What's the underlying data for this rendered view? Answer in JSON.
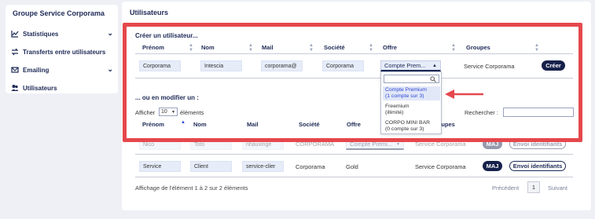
{
  "sidebar": {
    "title": "Groupe Service Corporama",
    "items": [
      {
        "label": "Statistiques",
        "icon": "chart-icon",
        "chevron": "⌄"
      },
      {
        "label": "Transferts entre utilisateurs",
        "icon": "transfer-icon"
      },
      {
        "label": "Emailing",
        "icon": "email-icon",
        "chevron": "⌄"
      },
      {
        "label": "Utilisateurs",
        "icon": "users-icon"
      }
    ]
  },
  "main": {
    "title": "Utilisateurs",
    "create": {
      "section_label": "Créer un utilisateur...",
      "headers": [
        "Prénom",
        "Nom",
        "Mail",
        "Société",
        "Offre",
        "Groupes"
      ],
      "inputs": {
        "prenom": "Corporama",
        "nom": "Intescia",
        "mail": "corporama@",
        "societe": "Corporama",
        "offre": "Compte Prem..."
      },
      "groupe": "Service Corporama",
      "create_button": "Créer"
    },
    "dropdown": {
      "options": [
        {
          "line1": "Compte Premium",
          "line2": "(1 compte sur 3)",
          "selected": true
        },
        {
          "line1": "Freemium",
          "line2": "(illimité)",
          "selected": false
        },
        {
          "line1": "CORPO MINI BAR",
          "line2": "(0 compte sur 3)",
          "selected": false
        }
      ]
    },
    "modify": {
      "section_label": "... ou en modifier un :",
      "show_prefix": "Afficher",
      "show_value": "10",
      "show_suffix": "éléments",
      "search_label": "Rechercher :",
      "headers": [
        "Prénom",
        "Nom",
        "Mail",
        "Société",
        "Offre",
        "Groupes"
      ],
      "rows": [
        {
          "prenom": "Nico",
          "nom": "Toto",
          "mail": "nhauvinge",
          "societe": "CORPORAMA",
          "offre": "Compte Premi...",
          "groupe": "Service Corporama",
          "maj": "MAJ",
          "envoi": "Envoi identifiants"
        },
        {
          "prenom": "Service",
          "nom": "Client",
          "mail": "service-clier",
          "societe": "Corporama",
          "offre": "Gold",
          "groupe": "Service Corporama",
          "maj": "MAJ",
          "envoi": "Envoi identifiants"
        }
      ],
      "info": "Affichage de l'élément 1 à 2 sur 2 éléments",
      "prev": "Précédent",
      "page": "1",
      "next": "Suivant"
    }
  },
  "colors": {
    "accent": "#16214a",
    "highlight": "#e5484d",
    "input_bg": "#e6ecf8"
  }
}
